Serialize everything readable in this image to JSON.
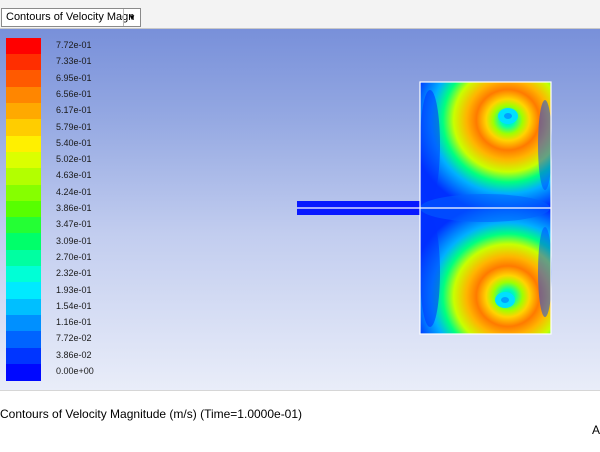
{
  "toolbar": {
    "display_select": "Contours of Velocity Magn"
  },
  "legend": {
    "colors": [
      "#ff0000",
      "#ff2e00",
      "#ff5a00",
      "#ff8600",
      "#ffa900",
      "#ffcd00",
      "#fff000",
      "#dbff00",
      "#b3ff00",
      "#86ff00",
      "#57ff00",
      "#24ff34",
      "#00ff6a",
      "#00ffa1",
      "#00ffd6",
      "#00eaff",
      "#00bfff",
      "#0090ff",
      "#0064ff",
      "#0035ff",
      "#0008ff"
    ],
    "ticks": [
      "7.72e-01",
      "7.33e-01",
      "6.95e-01",
      "6.56e-01",
      "6.17e-01",
      "5.79e-01",
      "5.40e-01",
      "5.02e-01",
      "4.63e-01",
      "4.24e-01",
      "3.86e-01",
      "3.47e-01",
      "3.09e-01",
      "2.70e-01",
      "2.32e-01",
      "1.93e-01",
      "1.54e-01",
      "1.16e-01",
      "7.72e-02",
      "3.86e-02",
      "0.00e+00"
    ]
  },
  "caption": {
    "text": "Contours of Velocity Magnitude (m/s)  (Time=1.0000e-01)"
  },
  "corner": {
    "text": "A"
  }
}
